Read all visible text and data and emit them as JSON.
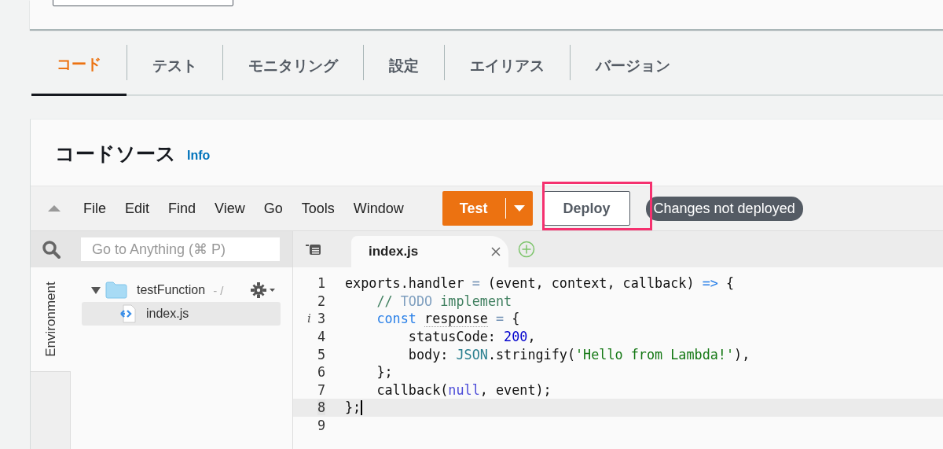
{
  "top_card": {
    "field": {
      "kind": "text"
    }
  },
  "tabs": [
    {
      "label": "コード",
      "selected": true
    },
    {
      "label": "テスト",
      "selected": false
    },
    {
      "label": "モニタリング",
      "selected": false
    },
    {
      "label": "設定",
      "selected": false
    },
    {
      "label": "エイリアス",
      "selected": false
    },
    {
      "label": "バージョン",
      "selected": false
    }
  ],
  "code_source": {
    "title": "コードソース",
    "info_link": "Info",
    "menu": [
      "File",
      "Edit",
      "Find",
      "View",
      "Go",
      "Tools",
      "Window"
    ],
    "test_button": {
      "label": "Test"
    },
    "deploy_button": {
      "label": "Deploy",
      "highlighted": true
    },
    "status_badge": "Changes not deployed",
    "search": {
      "placeholder": "Go to Anything (⌘ P)"
    },
    "side_tab": "Environment",
    "tree": [
      {
        "name": "testFunction",
        "suffix": "- /",
        "kind": "folder",
        "expanded": true,
        "selected": false,
        "children": [
          {
            "name": "index.js",
            "kind": "file",
            "selected": true
          }
        ]
      }
    ],
    "editor_tabs": [
      {
        "label": "index.js",
        "selected": true
      }
    ],
    "lines": [
      {
        "number": "1",
        "current": false,
        "tokens": [
          {
            "text": "exports.handler ",
            "kind": "plain"
          },
          {
            "text": "=",
            "kind": "operator"
          },
          {
            "text": " (event, context, callback) ",
            "kind": "plain"
          },
          {
            "text": "=>",
            "kind": "keyword"
          },
          {
            "text": " {",
            "kind": "plain"
          }
        ]
      },
      {
        "number": "2",
        "current": false,
        "tokens": [
          {
            "text": "    // ",
            "kind": "comment"
          },
          {
            "text": "TODO",
            "kind": "todo"
          },
          {
            "text": " implement",
            "kind": "comment"
          }
        ]
      },
      {
        "number": "3",
        "current": false,
        "marker": "i",
        "tokens": [
          {
            "text": "    const ",
            "kind": "keyword"
          },
          {
            "text": "response",
            "kind": "hint"
          },
          {
            "text": " =",
            "kind": "operator"
          },
          {
            "text": " {",
            "kind": "plain"
          }
        ]
      },
      {
        "number": "4",
        "current": false,
        "tokens": [
          {
            "text": "        statusCode: ",
            "kind": "plain"
          },
          {
            "text": "200",
            "kind": "number"
          },
          {
            "text": ",",
            "kind": "plain"
          }
        ]
      },
      {
        "number": "5",
        "current": false,
        "tokens": [
          {
            "text": "        body: ",
            "kind": "plain"
          },
          {
            "text": "JSON",
            "kind": "builtin"
          },
          {
            "text": ".stringify(",
            "kind": "plain"
          },
          {
            "text": "'Hello from Lambda!'",
            "kind": "string"
          },
          {
            "text": "),",
            "kind": "plain"
          }
        ]
      },
      {
        "number": "6",
        "current": false,
        "tokens": [
          {
            "text": "    };",
            "kind": "plain"
          }
        ]
      },
      {
        "number": "7",
        "current": false,
        "tokens": [
          {
            "text": "    callback(",
            "kind": "plain"
          },
          {
            "text": "null",
            "kind": "constant"
          },
          {
            "text": ", event);",
            "kind": "plain"
          }
        ]
      },
      {
        "number": "8",
        "current": true,
        "tokens": [
          {
            "text": "};",
            "kind": "plain"
          }
        ]
      },
      {
        "number": "9",
        "current": false
      }
    ]
  }
}
